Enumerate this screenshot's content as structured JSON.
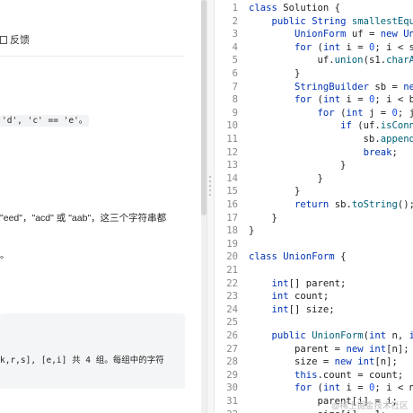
{
  "left_panel": {
    "feedback_label": "反馈",
    "text_1": "'d', 'c' == 'e'。",
    "text_2_pre": "\"eed\"，\"acd\" 或 \"aab\"，这三个字符串都",
    "text_3": "。",
    "codeblock_text": "k,r,s], [e,i] 共 4 组。每组中的字符"
  },
  "editor": {
    "line_numbers": [
      "1",
      "2",
      "3",
      "4",
      "5",
      "6",
      "7",
      "8",
      "9",
      "10",
      "11",
      "12",
      "13",
      "14",
      "15",
      "16",
      "17",
      "18",
      "19",
      "20",
      "21",
      "22",
      "23",
      "24",
      "25",
      "26",
      "27",
      "28",
      "29",
      "30",
      "31",
      "32"
    ]
  },
  "watermark": "@稀土掘金技术社区"
}
